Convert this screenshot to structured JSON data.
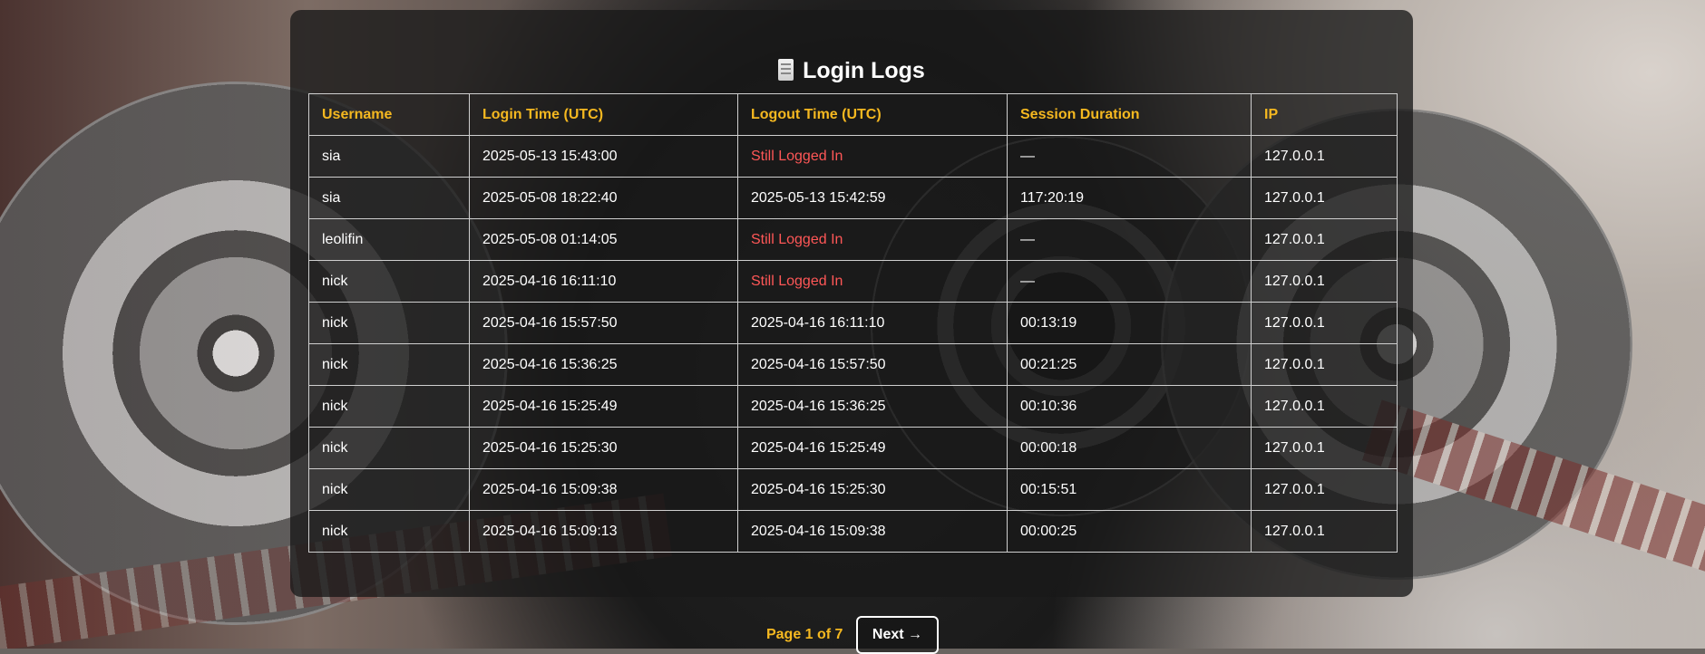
{
  "page": {
    "title": "Login Logs",
    "icon": "page-icon"
  },
  "table": {
    "headers": [
      "Username",
      "Login Time (UTC)",
      "Logout Time (UTC)",
      "Session Duration",
      "IP"
    ],
    "rows": [
      {
        "username": "sia",
        "login": "2025-05-13 15:43:00",
        "logout": "Still Logged In",
        "duration": "—",
        "ip": "127.0.0.1"
      },
      {
        "username": "sia",
        "login": "2025-05-08 18:22:40",
        "logout": "2025-05-13 15:42:59",
        "duration": "117:20:19",
        "ip": "127.0.0.1"
      },
      {
        "username": "leolifin",
        "login": "2025-05-08 01:14:05",
        "logout": "Still Logged In",
        "duration": "—",
        "ip": "127.0.0.1"
      },
      {
        "username": "nick",
        "login": "2025-04-16 16:11:10",
        "logout": "Still Logged In",
        "duration": "—",
        "ip": "127.0.0.1"
      },
      {
        "username": "nick",
        "login": "2025-04-16 15:57:50",
        "logout": "2025-04-16 16:11:10",
        "duration": "00:13:19",
        "ip": "127.0.0.1"
      },
      {
        "username": "nick",
        "login": "2025-04-16 15:36:25",
        "logout": "2025-04-16 15:57:50",
        "duration": "00:21:25",
        "ip": "127.0.0.1"
      },
      {
        "username": "nick",
        "login": "2025-04-16 15:25:49",
        "logout": "2025-04-16 15:36:25",
        "duration": "00:10:36",
        "ip": "127.0.0.1"
      },
      {
        "username": "nick",
        "login": "2025-04-16 15:25:30",
        "logout": "2025-04-16 15:25:49",
        "duration": "00:00:18",
        "ip": "127.0.0.1"
      },
      {
        "username": "nick",
        "login": "2025-04-16 15:09:38",
        "logout": "2025-04-16 15:25:30",
        "duration": "00:15:51",
        "ip": "127.0.0.1"
      },
      {
        "username": "nick",
        "login": "2025-04-16 15:09:13",
        "logout": "2025-04-16 15:09:38",
        "duration": "00:00:25",
        "ip": "127.0.0.1"
      }
    ]
  },
  "pagination": {
    "page_info": "Page 1 of 7",
    "next_label": "Next →"
  },
  "colors": {
    "header_text": "#f5b820",
    "still_logged_in": "#ff5757",
    "panel_bg": "#181818"
  }
}
